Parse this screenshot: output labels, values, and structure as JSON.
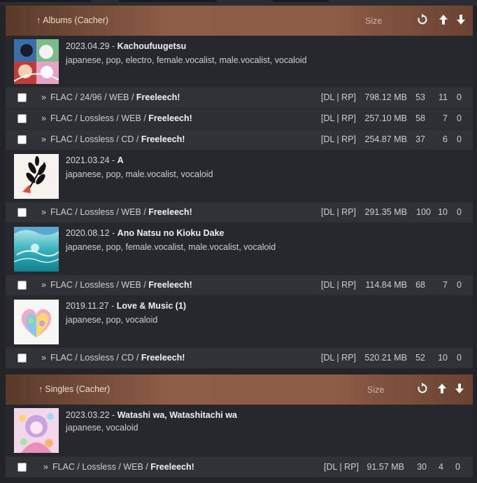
{
  "sections": [
    {
      "title": "Albums (Cacher)",
      "size_label": "Size",
      "albums": [
        {
          "date": "2023.04.29",
          "title": "Kachoufuugetsu",
          "tags": "japanese, pop, electro, female.vocalist, male.vocalist, vocaloid",
          "torrents": [
            {
              "format": "FLAC / 24/96 / WEB",
              "free": "Freeleech!",
              "dl": "[DL | RP]",
              "size": "798.12 MB",
              "snatches": "53",
              "seeders": "11",
              "leechers": "0"
            },
            {
              "format": "FLAC / Lossless / WEB",
              "free": "Freeleech!",
              "dl": "[DL | RP]",
              "size": "257.10 MB",
              "snatches": "58",
              "seeders": "7",
              "leechers": "0"
            },
            {
              "format": "FLAC / Lossless / CD",
              "free": "Freeleech!",
              "dl": "[DL | RP]",
              "size": "254.87 MB",
              "snatches": "37",
              "seeders": "6",
              "leechers": "0"
            }
          ]
        },
        {
          "date": "2021.03.24",
          "title": "A",
          "tags": "japanese, pop, male.vocalist, vocaloid",
          "torrents": [
            {
              "format": "FLAC / Lossless / WEB",
              "free": "Freeleech!",
              "dl": "[DL | RP]",
              "size": "291.35 MB",
              "snatches": "100",
              "seeders": "10",
              "leechers": "0"
            }
          ]
        },
        {
          "date": "2020.08.12",
          "title": "Ano Natsu no Kioku Dake",
          "tags": "japanese, pop, female.vocalist, male.vocalist, vocaloid",
          "torrents": [
            {
              "format": "FLAC / Lossless / WEB",
              "free": "Freeleech!",
              "dl": "[DL | RP]",
              "size": "114.84 MB",
              "snatches": "68",
              "seeders": "7",
              "leechers": "0"
            }
          ]
        },
        {
          "date": "2019.11.27",
          "title": "Love & Music (1)",
          "tags": "japanese, pop, vocaloid",
          "torrents": [
            {
              "format": "FLAC / Lossless / CD",
              "free": "Freeleech!",
              "dl": "[DL | RP]",
              "size": "520.21 MB",
              "snatches": "52",
              "seeders": "10",
              "leechers": "0"
            }
          ]
        }
      ]
    },
    {
      "title": "Singles (Cacher)",
      "size_label": "Size",
      "albums": [
        {
          "date": "2023.03.22",
          "title": "Watashi wa, Watashitachi wa",
          "tags": "japanese, vocaloid",
          "torrents": [
            {
              "format": "FLAC / Lossless / WEB",
              "free": "Freeleech!",
              "dl": "[DL | RP]",
              "size": "91.57 MB",
              "snatches": "30",
              "seeders": "4",
              "leechers": "0"
            }
          ]
        }
      ]
    }
  ],
  "icons": {
    "refresh": "refresh-icon",
    "up": "arrow-up-icon",
    "down": "arrow-down-icon",
    "collapse": "up-arrow-icon"
  }
}
